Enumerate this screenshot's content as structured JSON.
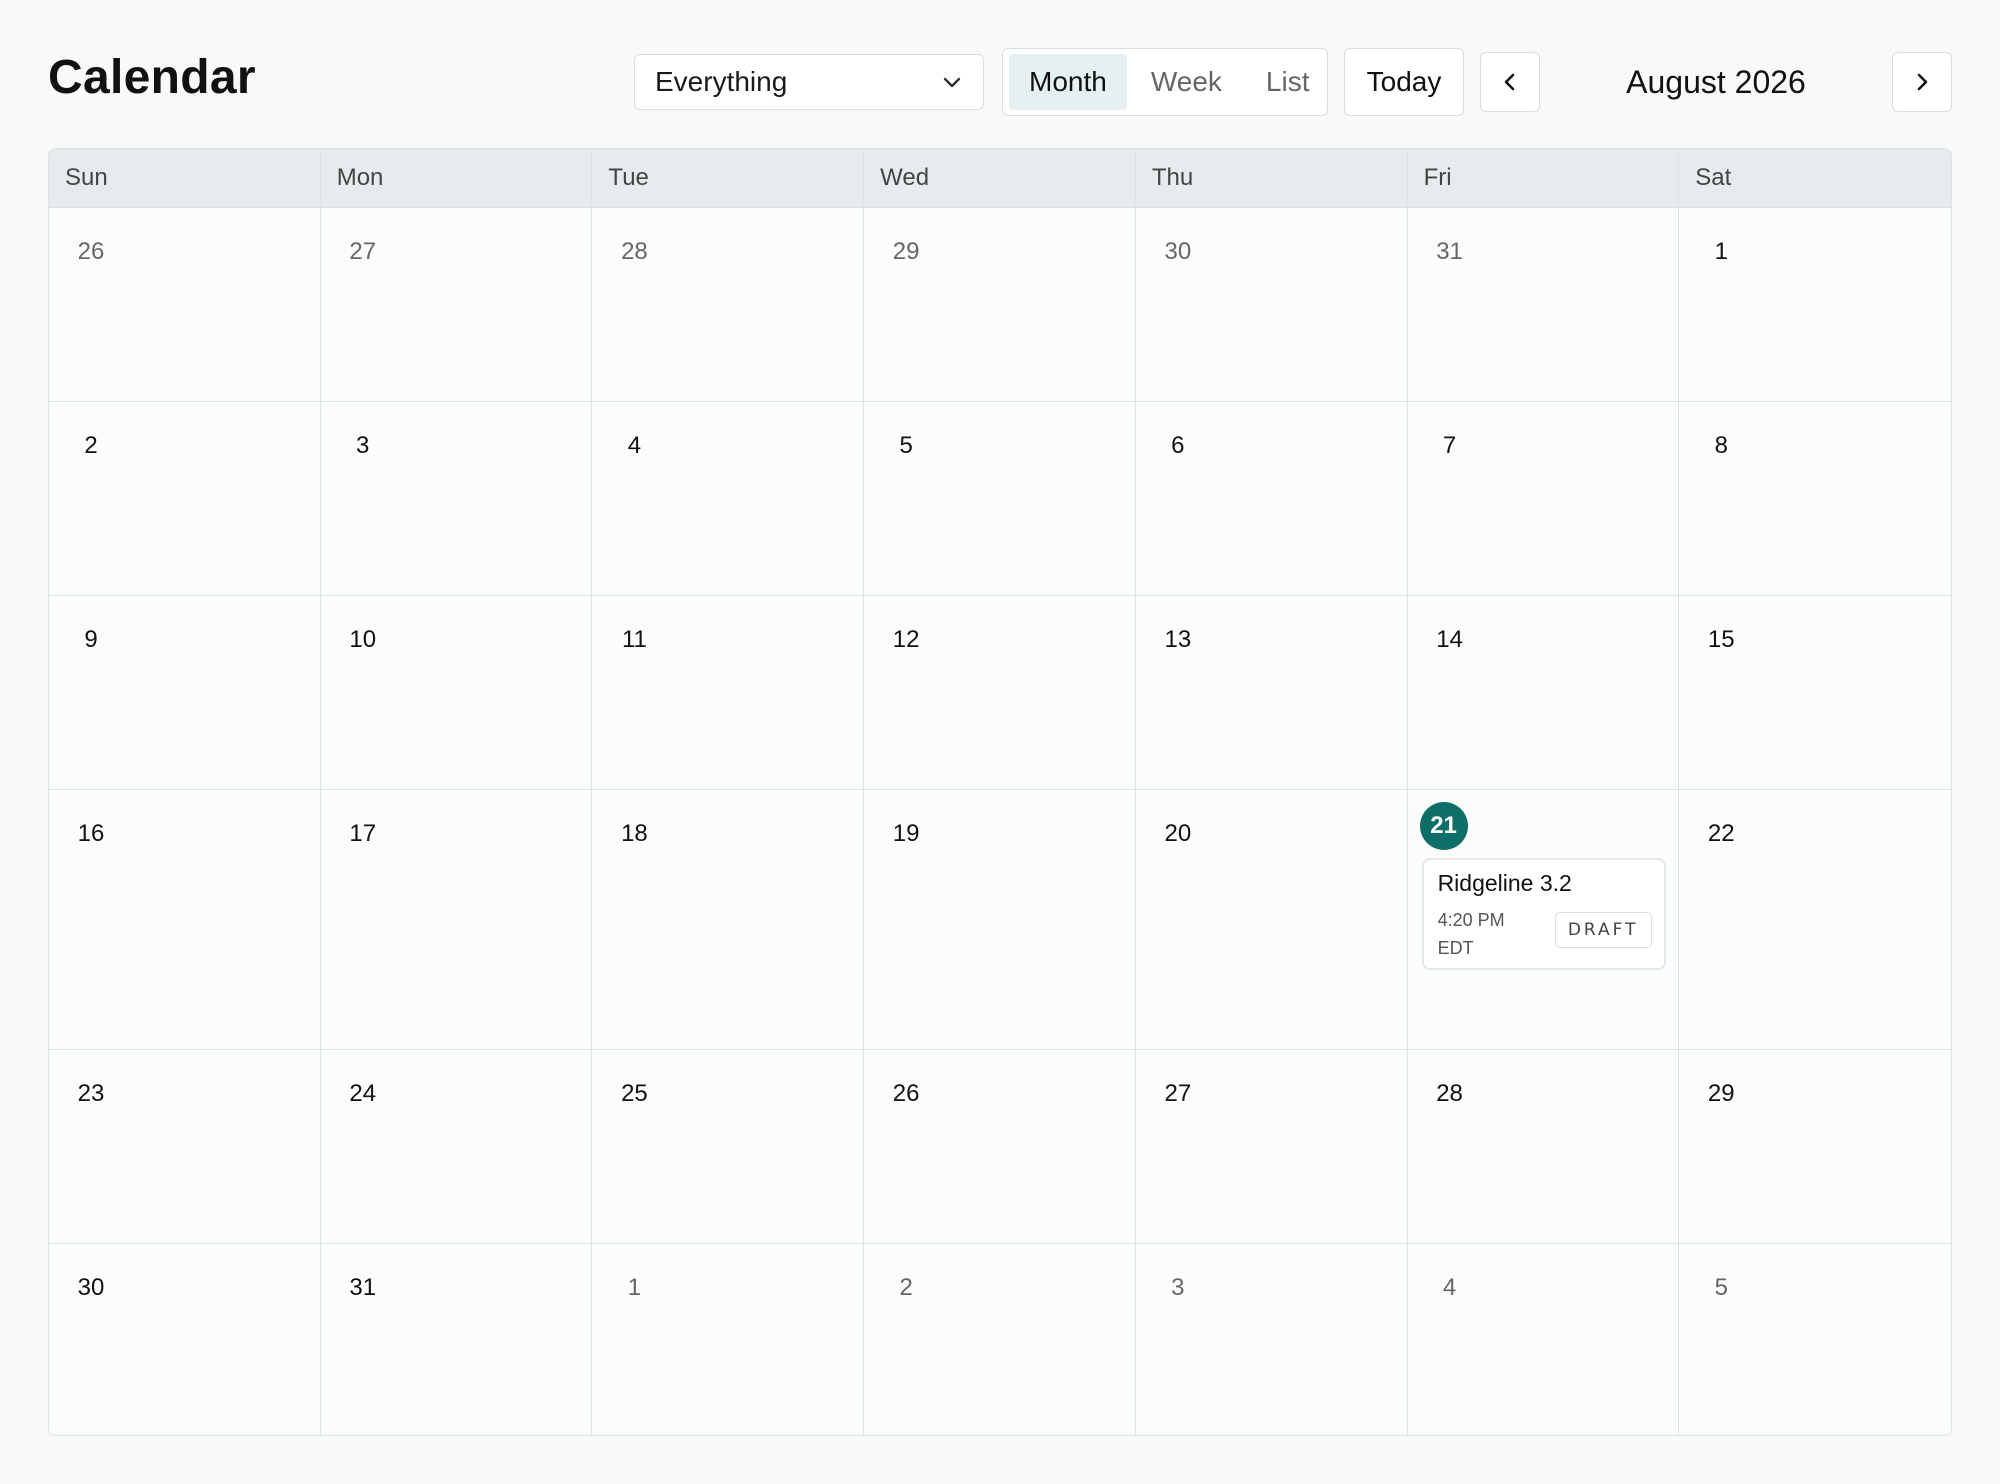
{
  "header": {
    "title": "Calendar",
    "filter": {
      "selected": "Everything",
      "icon": "chevron-down-icon"
    },
    "views": [
      {
        "label": "Month",
        "active": true
      },
      {
        "label": "Week",
        "active": false
      },
      {
        "label": "List",
        "active": false
      }
    ],
    "today_label": "Today",
    "prev_icon": "chevron-left-icon",
    "next_icon": "chevron-right-icon",
    "current_month": "August 2026"
  },
  "calendar": {
    "weekdays": [
      "Sun",
      "Mon",
      "Tue",
      "Wed",
      "Thu",
      "Fri",
      "Sat"
    ],
    "weeks": [
      [
        "26",
        "27",
        "28",
        "29",
        "30",
        "31",
        "1"
      ],
      [
        "2",
        "3",
        "4",
        "5",
        "6",
        "7",
        "8"
      ],
      [
        "9",
        "10",
        "11",
        "12",
        "13",
        "14",
        "15"
      ],
      [
        "16",
        "17",
        "18",
        "19",
        "20",
        "21",
        "22"
      ],
      [
        "23",
        "24",
        "25",
        "26",
        "27",
        "28",
        "29"
      ],
      [
        "30",
        "31",
        "1",
        "2",
        "3",
        "4",
        "5"
      ]
    ],
    "today": "21",
    "event": {
      "title": "Ridgeline 3.2",
      "time": "4:20 PM EDT",
      "status": "DRAFT"
    }
  },
  "colors": {
    "accent": "#0e6e68",
    "header_bg": "#e6ecee",
    "active_seg": "#e5f1f1"
  }
}
